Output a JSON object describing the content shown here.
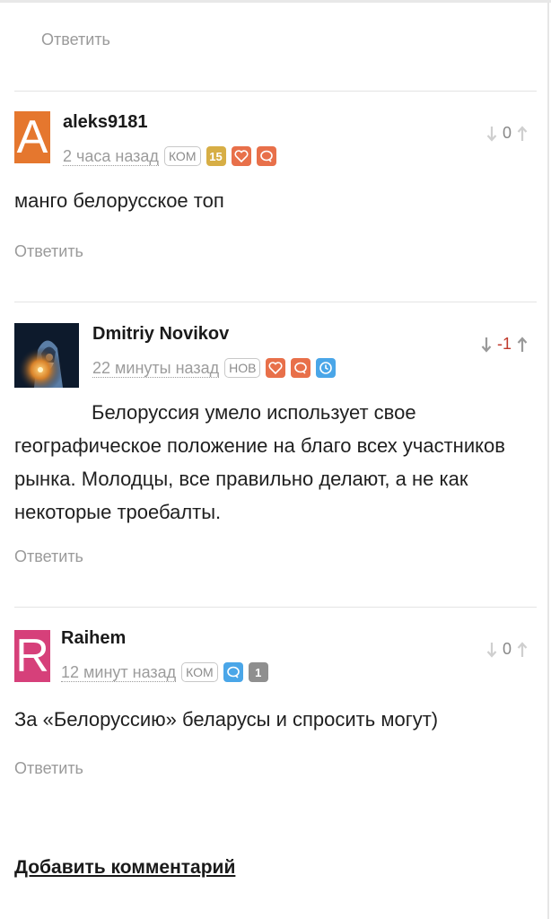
{
  "reply_label": "Ответить",
  "add_comment_label": "Добавить комментарий",
  "comments": [
    {
      "avatar_letter": "A",
      "avatar_color": "#e5772e",
      "username": "aleks9181",
      "time": "2 часа назад",
      "tag": "КОМ",
      "level": "15",
      "badges": [
        "heart-icon",
        "comment-icon"
      ],
      "score": "0",
      "text": "манго белорусское топ"
    },
    {
      "avatar": "photo",
      "username": "Dmitriy Novikov",
      "time": "22 минуты назад",
      "tag": "НОВ",
      "badges": [
        "heart-icon",
        "comment-icon",
        "clock-icon"
      ],
      "score": "-1",
      "text": "Белоруссия умело использует свое географическое положение на благо всех участников рынка. Молодцы, все правильно делают, а не как некоторые троебалты."
    },
    {
      "avatar_letter": "R",
      "avatar_color": "#d6407a",
      "username": "Raihem",
      "time": "12 минут назад",
      "tag": "КОМ",
      "level": "1",
      "badges": [
        "comment-icon"
      ],
      "score": "0",
      "text": "За «Белоруссию» беларусы и спросить могут)"
    }
  ],
  "colors": {
    "badge_orange": "#e8704a",
    "badge_gold": "#d7ae45",
    "badge_blue": "#4aa6e8",
    "badge_gray": "#8f8f8f",
    "negative": "#c0392b"
  }
}
